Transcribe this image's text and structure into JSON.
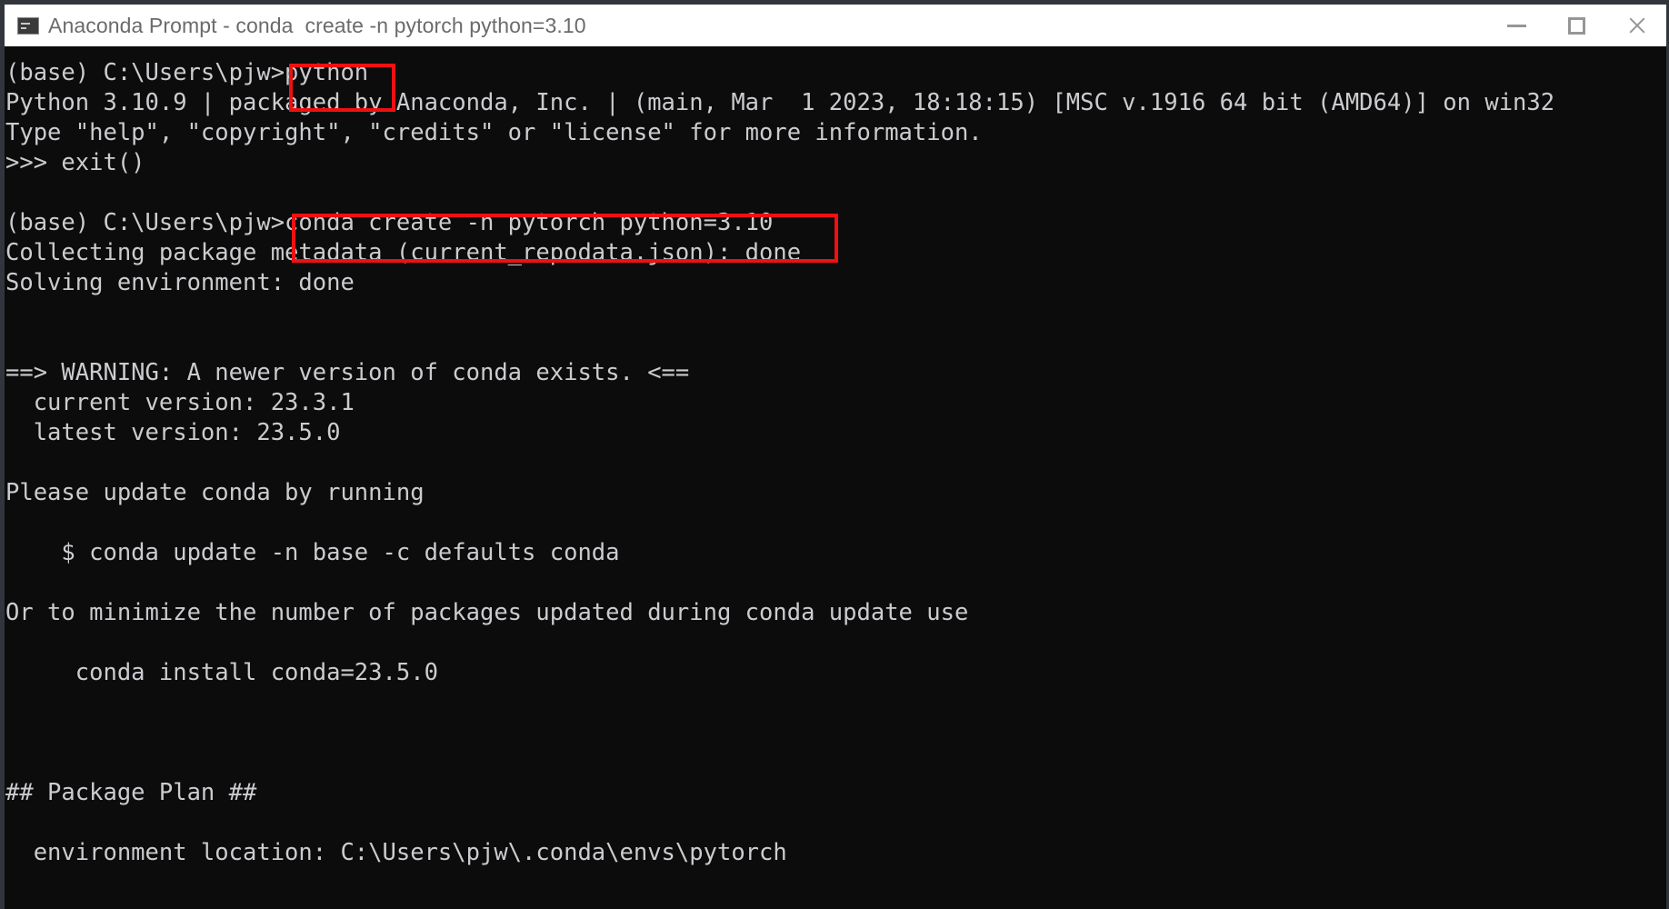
{
  "window": {
    "title": "Anaconda Prompt - conda  create -n pytorch python=3.10",
    "icon": "console-window-icon",
    "controls": {
      "minimize_label": "Minimize",
      "maximize_label": "Maximize",
      "close_label": "Close"
    },
    "colors": {
      "titlebar_bg": "#ffffff",
      "titlebar_text": "#6b6b6b",
      "terminal_bg": "#0c0c0c",
      "terminal_text": "#ccccd0",
      "annotation": "#ee1111",
      "window_border": "#32363c"
    }
  },
  "terminal": {
    "prompt_base": "(base) C:\\Users\\pjw>",
    "lines": [
      "(base) C:\\Users\\pjw>python",
      "Python 3.10.9 | packaged by Anaconda, Inc. | (main, Mar  1 2023, 18:18:15) [MSC v.1916 64 bit (AMD64)] on win32",
      "Type \"help\", \"copyright\", \"credits\" or \"license\" for more information.",
      ">>> exit()",
      "",
      "(base) C:\\Users\\pjw>conda create -n pytorch python=3.10",
      "Collecting package metadata (current_repodata.json): done",
      "Solving environment: done",
      "",
      "",
      "==> WARNING: A newer version of conda exists. <==",
      "  current version: 23.3.1",
      "  latest version: 23.5.0",
      "",
      "Please update conda by running",
      "",
      "    $ conda update -n base -c defaults conda",
      "",
      "Or to minimize the number of packages updated during conda update use",
      "",
      "     conda install conda=23.5.0",
      "",
      "",
      "",
      "## Package Plan ##",
      "",
      "  environment location: C:\\Users\\pjw\\.conda\\envs\\pytorch"
    ]
  },
  "annotations": [
    {
      "name": "python-command-highlight",
      "text": "python",
      "shape": "rectangle",
      "color": "#ee1111"
    },
    {
      "name": "conda-create-command-highlight",
      "text": "conda create -n pytorch python=3.10",
      "shape": "rectangle",
      "color": "#ee1111"
    }
  ]
}
